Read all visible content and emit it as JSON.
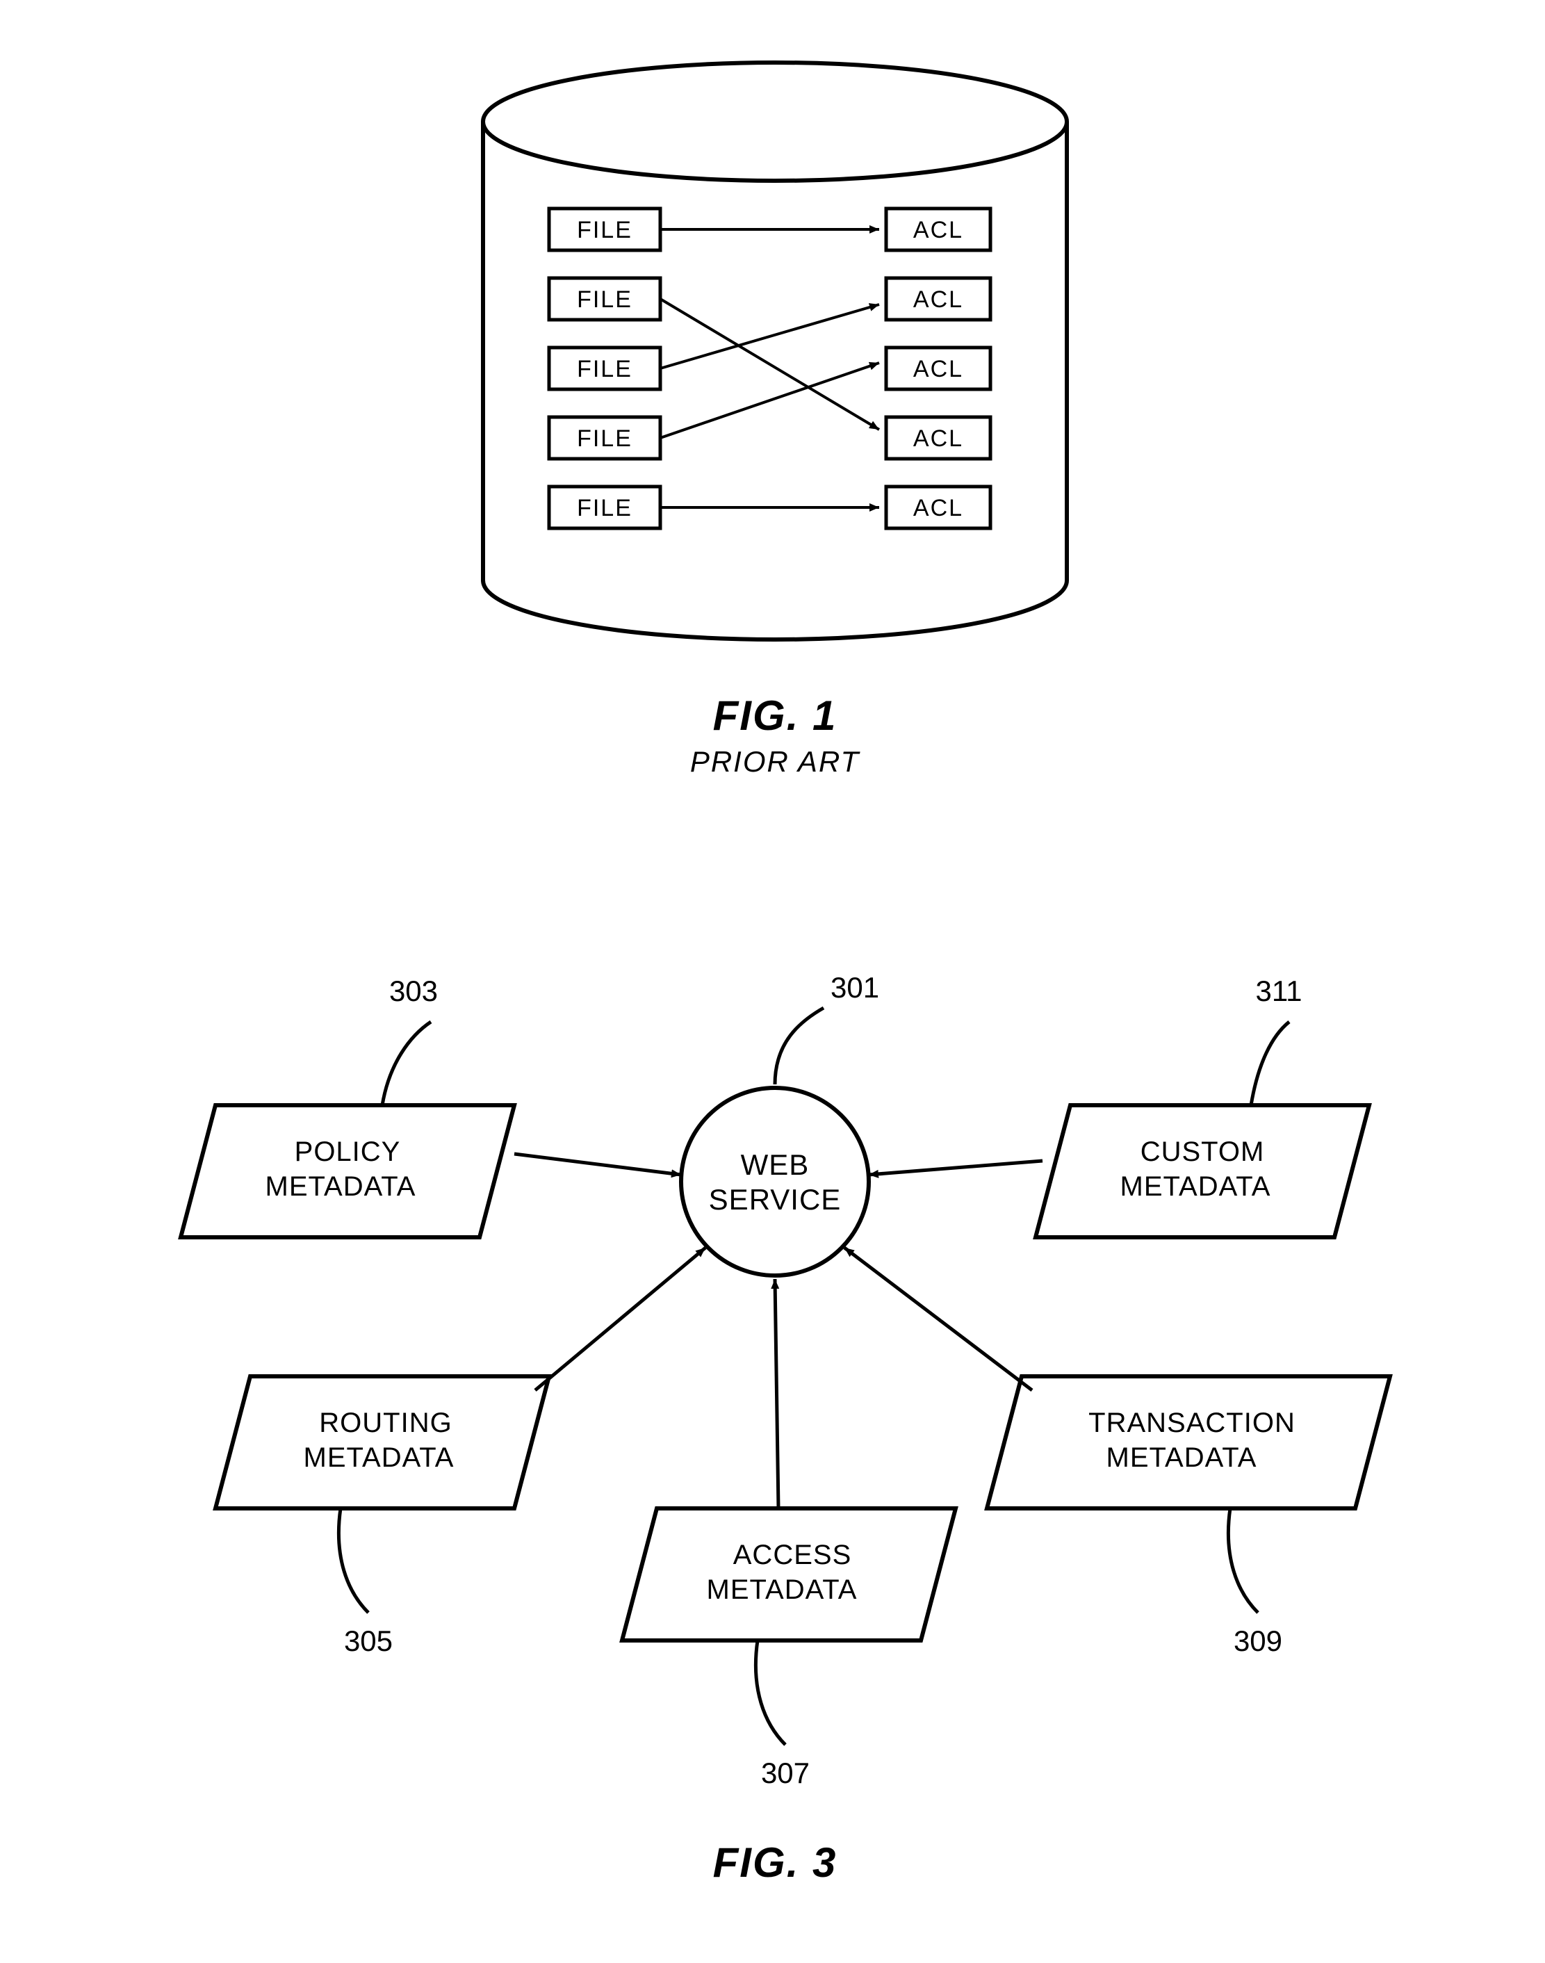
{
  "fig1": {
    "title": "FIG. 1",
    "subtitle": "PRIOR ART",
    "left_labels": [
      "FILE",
      "FILE",
      "FILE",
      "FILE",
      "FILE"
    ],
    "right_labels": [
      "ACL",
      "ACL",
      "ACL",
      "ACL",
      "ACL"
    ]
  },
  "fig3": {
    "title": "FIG. 3",
    "center": {
      "line1": "WEB",
      "line2": "SERVICE",
      "ref": "301"
    },
    "nodes": {
      "policy": {
        "line1": "POLICY",
        "line2": "METADATA",
        "ref": "303"
      },
      "custom": {
        "line1": "CUSTOM",
        "line2": "METADATA",
        "ref": "311"
      },
      "routing": {
        "line1": "ROUTING",
        "line2": "METADATA",
        "ref": "305"
      },
      "transaction": {
        "line1": "TRANSACTION",
        "line2": "METADATA",
        "ref": "309"
      },
      "access": {
        "line1": "ACCESS",
        "line2": "METADATA",
        "ref": "307"
      }
    }
  }
}
